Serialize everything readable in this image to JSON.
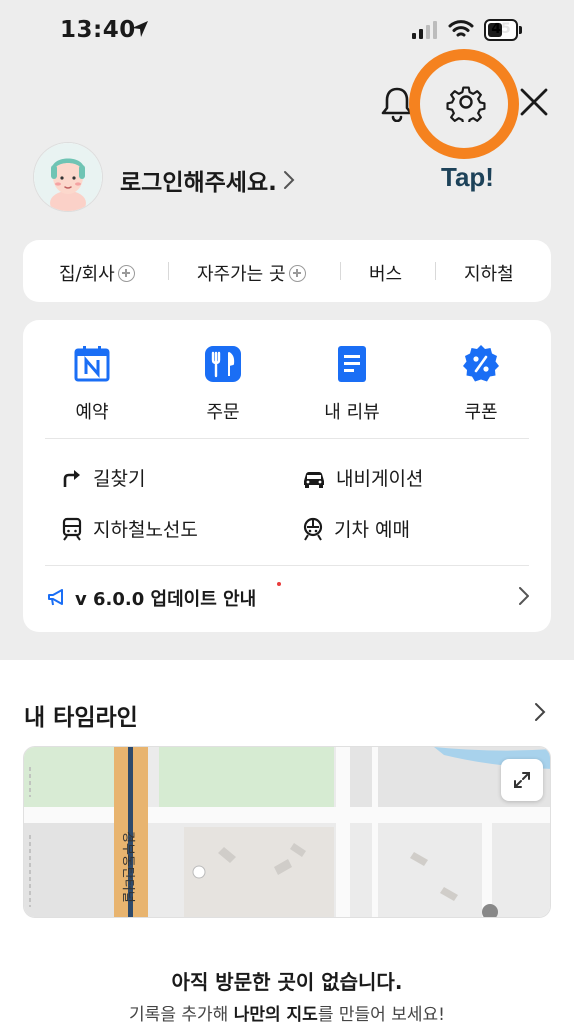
{
  "status_bar": {
    "time": "13:40",
    "battery": "45"
  },
  "header": {
    "tap_hint": "Tap!"
  },
  "profile": {
    "login_text": "로그인해주세요."
  },
  "quick_links": [
    {
      "label": "집/회사",
      "has_add": true
    },
    {
      "label": "자주가는 곳",
      "has_add": true
    },
    {
      "label": "버스",
      "has_add": false
    },
    {
      "label": "지하철",
      "has_add": false
    }
  ],
  "menu": {
    "icons": [
      {
        "label": "예약",
        "icon": "calendar-n-icon"
      },
      {
        "label": "주문",
        "icon": "fork-knife-icon"
      },
      {
        "label": "내 리뷰",
        "icon": "document-icon"
      },
      {
        "label": "쿠폰",
        "icon": "percent-badge-icon"
      }
    ],
    "rows": [
      {
        "label": "길찾기",
        "icon": "turn-arrow-icon"
      },
      {
        "label": "내비게이션",
        "icon": "car-icon"
      },
      {
        "label": "지하철노선도",
        "icon": "subway-icon"
      },
      {
        "label": "기차 예매",
        "icon": "train-icon"
      }
    ],
    "update_notice": "v 6.0.0 업데이트 안내"
  },
  "timeline": {
    "title": "내 타임라인",
    "map_road_label": "경부동탄터널",
    "empty_title": "아직 방문한 곳이 없습니다.",
    "empty_sub_prefix": "기록을 추가해 ",
    "empty_sub_bold": "나만의 지도",
    "empty_sub_suffix": "를 만들어 보세요!"
  },
  "colors": {
    "accent_blue": "#1a6ef5",
    "highlight_orange": "#f5821f",
    "tap_text": "#1d4259"
  }
}
